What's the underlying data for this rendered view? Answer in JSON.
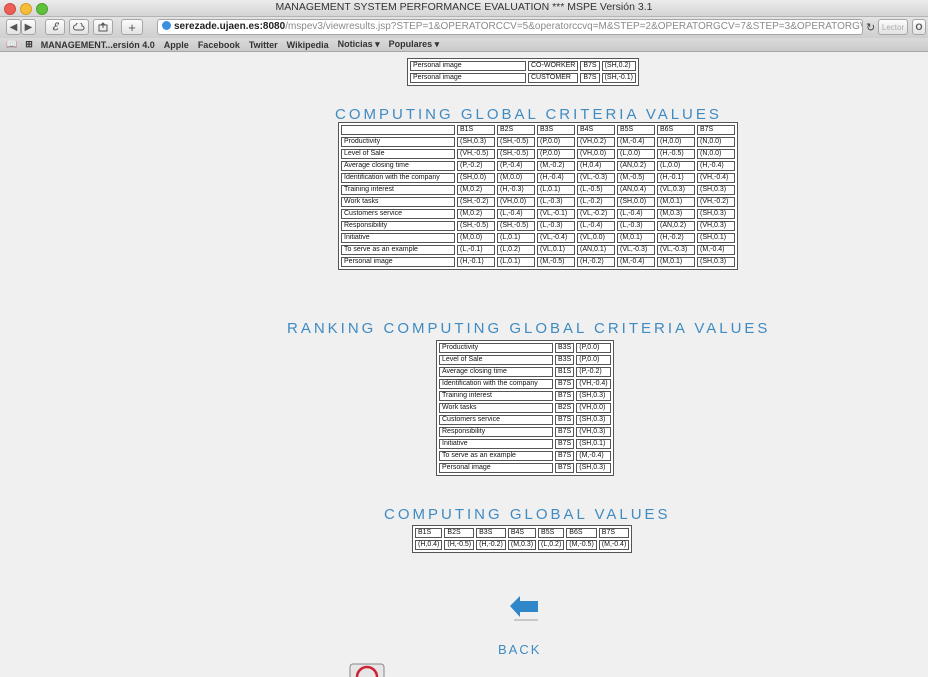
{
  "window": {
    "title": "MANAGEMENT SYSTEM PERFORMANCE EVALUATION *** MSPE Versión 3.1"
  },
  "toolbar": {
    "url_host": "serezade.ujaen.es:8080",
    "url_path": "/mspev3/viewresults.jsp?STEP=1&OPERATORCCV=5&operatorccvq=M&STEP=2&OPERATORGCV=7&STEP=3&OPERATORGV=6&fuzzyv1",
    "reader_label": "Lector"
  },
  "bookmarks": [
    "MANAGEMENT...ersión 4.0",
    "Apple",
    "Facebook",
    "Twitter",
    "Wikipedia",
    "Noticias ▾",
    "Populares ▾"
  ],
  "top_rows": [
    [
      "Personal image",
      "CO-WORKER",
      "B7S",
      "(SH,0.2)"
    ],
    [
      "Personal image",
      "CUSTOMER",
      "B7S",
      "(SH,-0.1)"
    ]
  ],
  "global_criteria": {
    "heading": "COMPUTING GLOBAL CRITERIA VALUES",
    "columns": [
      "",
      "B1S",
      "B2S",
      "B3S",
      "B4S",
      "B5S",
      "B6S",
      "B7S"
    ],
    "rows": [
      [
        "Productivity",
        "(SH,0.3)",
        "(SH,-0.5)",
        "(P,0.0)",
        "(VH,0.2)",
        "(M,-0.4)",
        "(H,0.0)",
        "(N,0.0)"
      ],
      [
        "Level of Sale",
        "(VH,-0.5)",
        "(SH,-0.5)",
        "(P,0.0)",
        "(VH,0.0)",
        "(L,0.0)",
        "(H,-0.5)",
        "(N,0.0)"
      ],
      [
        "Average closing time",
        "(P,-0.2)",
        "(P,-0.4)",
        "(M,-0.2)",
        "(H,0.4)",
        "(AN,0.2)",
        "(L,0.0)",
        "(H,-0.4)"
      ],
      [
        "Identification with the company",
        "(SH,0.0)",
        "(M,0.0)",
        "(H,-0.4)",
        "(VL,-0.3)",
        "(M,-0.5)",
        "(H,-0.1)",
        "(VH,-0.4)"
      ],
      [
        "Training interest",
        "(M,0.2)",
        "(H,-0.3)",
        "(L,0.1)",
        "(L,-0.5)",
        "(AN,0.4)",
        "(VL,0.3)",
        "(SH,0.3)"
      ],
      [
        "Work tasks",
        "(SH,-0.2)",
        "(VH,0.0)",
        "(L,-0.3)",
        "(L,-0.2)",
        "(SH,0.0)",
        "(M,0.1)",
        "(VH,-0.2)"
      ],
      [
        "Customers service",
        "(M,0.2)",
        "(L,-0.4)",
        "(VL,-0.1)",
        "(VL,-0.2)",
        "(L,-0.4)",
        "(M,0.3)",
        "(SH,0.3)"
      ],
      [
        "Responsibility",
        "(SH,-0.5)",
        "(SH,-0.5)",
        "(L,-0.3)",
        "(L,-0.4)",
        "(L,-0.3)",
        "(AN,0.2)",
        "(VH,0.3)"
      ],
      [
        "Initiative",
        "(M,0.0)",
        "(L,0.1)",
        "(VL,-0.4)",
        "(VL,0.0)",
        "(M,0.1)",
        "(H,-0.2)",
        "(SH,0.1)"
      ],
      [
        "To serve as an example",
        "(L,-0.1)",
        "(L,0.2)",
        "(VL,0.1)",
        "(AN,0.1)",
        "(VL,-0.3)",
        "(VL,-0.3)",
        "(M,-0.4)"
      ],
      [
        "Personal image",
        "(H,-0.1)",
        "(L,0.1)",
        "(M,-0.5)",
        "(H,-0.2)",
        "(M,-0.4)",
        "(M,0.1)",
        "(SH,0.3)"
      ]
    ]
  },
  "ranking": {
    "heading": "RANKING COMPUTING GLOBAL CRITERIA VALUES",
    "rows": [
      [
        "Productivity",
        "B3S",
        "(P,0.0)"
      ],
      [
        "Level of Sale",
        "B3S",
        "(P,0.0)"
      ],
      [
        "Average closing time",
        "B1S",
        "(P,-0.2)"
      ],
      [
        "Identification with the company",
        "B7S",
        "(VH,-0.4)"
      ],
      [
        "Training interest",
        "B7S",
        "(SH,0.3)"
      ],
      [
        "Work tasks",
        "B2S",
        "(VH,0.0)"
      ],
      [
        "Customers service",
        "B7S",
        "(SH,0.3)"
      ],
      [
        "Responsibility",
        "B7S",
        "(VH,0.3)"
      ],
      [
        "Initiative",
        "B7S",
        "(SH,0.1)"
      ],
      [
        "To serve as an example",
        "B7S",
        "(M,-0.4)"
      ],
      [
        "Personal image",
        "B7S",
        "(SH,0.3)"
      ]
    ]
  },
  "global_values": {
    "heading": "COMPUTING GLOBAL VALUES",
    "columns": [
      "B1S",
      "B2S",
      "B3S",
      "B4S",
      "B5S",
      "B6S",
      "B7S"
    ],
    "values": [
      "(H,0.4)",
      "(H,-0.5)",
      "(H,-0.2)",
      "(M,0.3)",
      "(L,0.2)",
      "(M,-0.5)",
      "(M,-0.4)"
    ]
  },
  "back": {
    "label": "BACK"
  },
  "colors": {
    "heading": "#3f8bc2",
    "background": "#f0f0f0"
  }
}
